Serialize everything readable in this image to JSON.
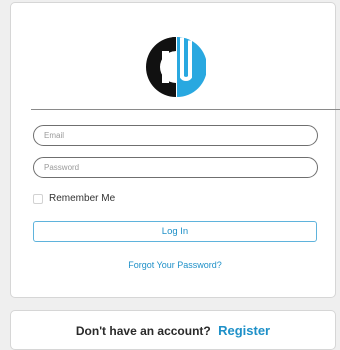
{
  "login": {
    "email_placeholder": "Email",
    "password_placeholder": "Password",
    "remember_label": "Remember Me",
    "remember_checked": false,
    "login_label": "Log In",
    "forgot_label": "Forgot Your Password?"
  },
  "register": {
    "prompt": "Don't have an account?",
    "link_label": "Register"
  },
  "colors": {
    "accent": "#1e90c8",
    "logo_dark": "#111111",
    "logo_blue": "#29a8e0"
  },
  "icons": {
    "logo": "cu-logo-icon"
  }
}
